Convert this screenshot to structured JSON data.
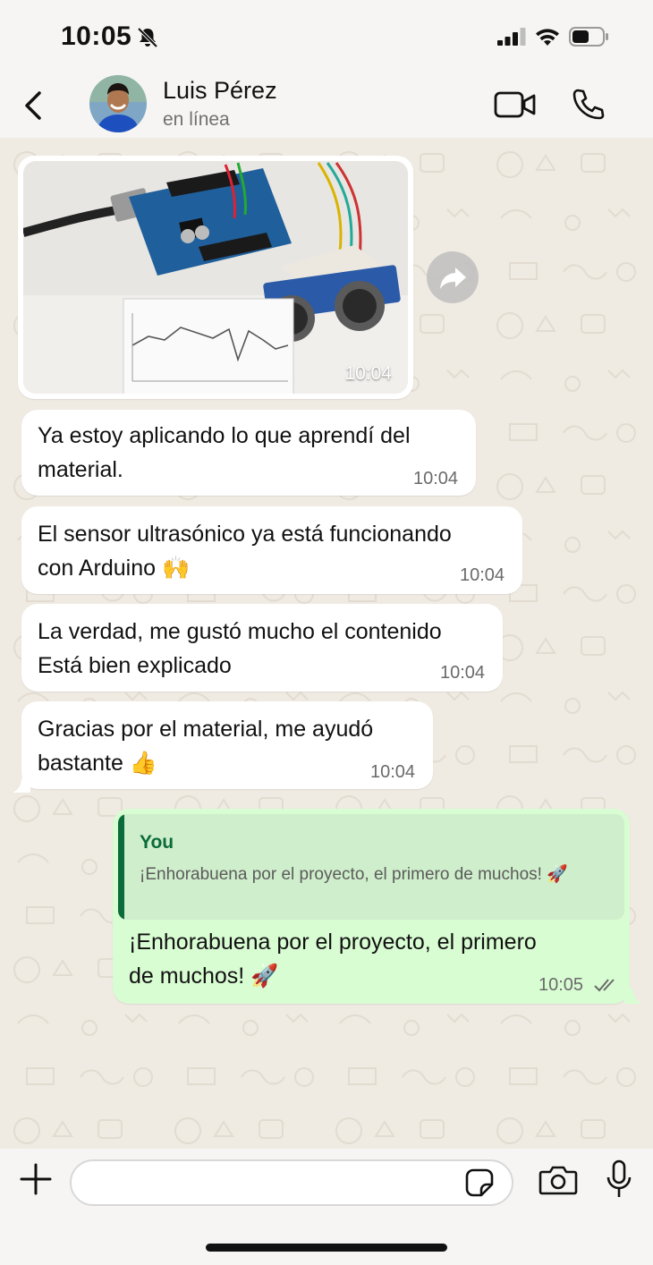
{
  "status_bar": {
    "time": "10:05",
    "icons": [
      "bell-off-icon",
      "signal-icon",
      "wifi-icon",
      "battery-icon"
    ]
  },
  "header": {
    "contact_name": "Luis Pérez",
    "contact_status": "en línea",
    "icons": [
      "back-icon",
      "video-call-icon",
      "phone-call-icon"
    ]
  },
  "messages": {
    "photo": {
      "time": "10:04",
      "icon": "forward-icon"
    },
    "incoming": [
      {
        "line1": "Ya estoy aplicando lo que aprendí del",
        "line2": "material.",
        "time": "10:04"
      },
      {
        "line1": "El sensor ultrasónico ya está funcionando",
        "line2": "con Arduino 🙌",
        "time": "10:04"
      },
      {
        "line1": "La verdad, me gustó mucho el contenido",
        "line2": "Está bien explicado",
        "time": "10:04"
      },
      {
        "line1": "Gracias por el material, me ayudó",
        "line2": "bastante 👍",
        "time": "10:04"
      }
    ],
    "outgoing": {
      "quote_author": "You",
      "quote_text": "¡Enhorabuena por el proyecto, el primero de muchos! 🚀",
      "line1": "¡Enhorabuena por el proyecto, el primero",
      "line2": "de muchos! 🚀",
      "time": "10:05",
      "status_icon": "double-check-icon"
    }
  },
  "input_bar": {
    "placeholder": "",
    "icons": [
      "plus-icon",
      "sticker-icon",
      "camera-icon",
      "microphone-icon"
    ]
  },
  "colors": {
    "background": "#efeae2",
    "incoming_bubble": "#ffffff",
    "outgoing_bubble": "#d9fdd3",
    "quote_accent": "#0b6b3a"
  }
}
